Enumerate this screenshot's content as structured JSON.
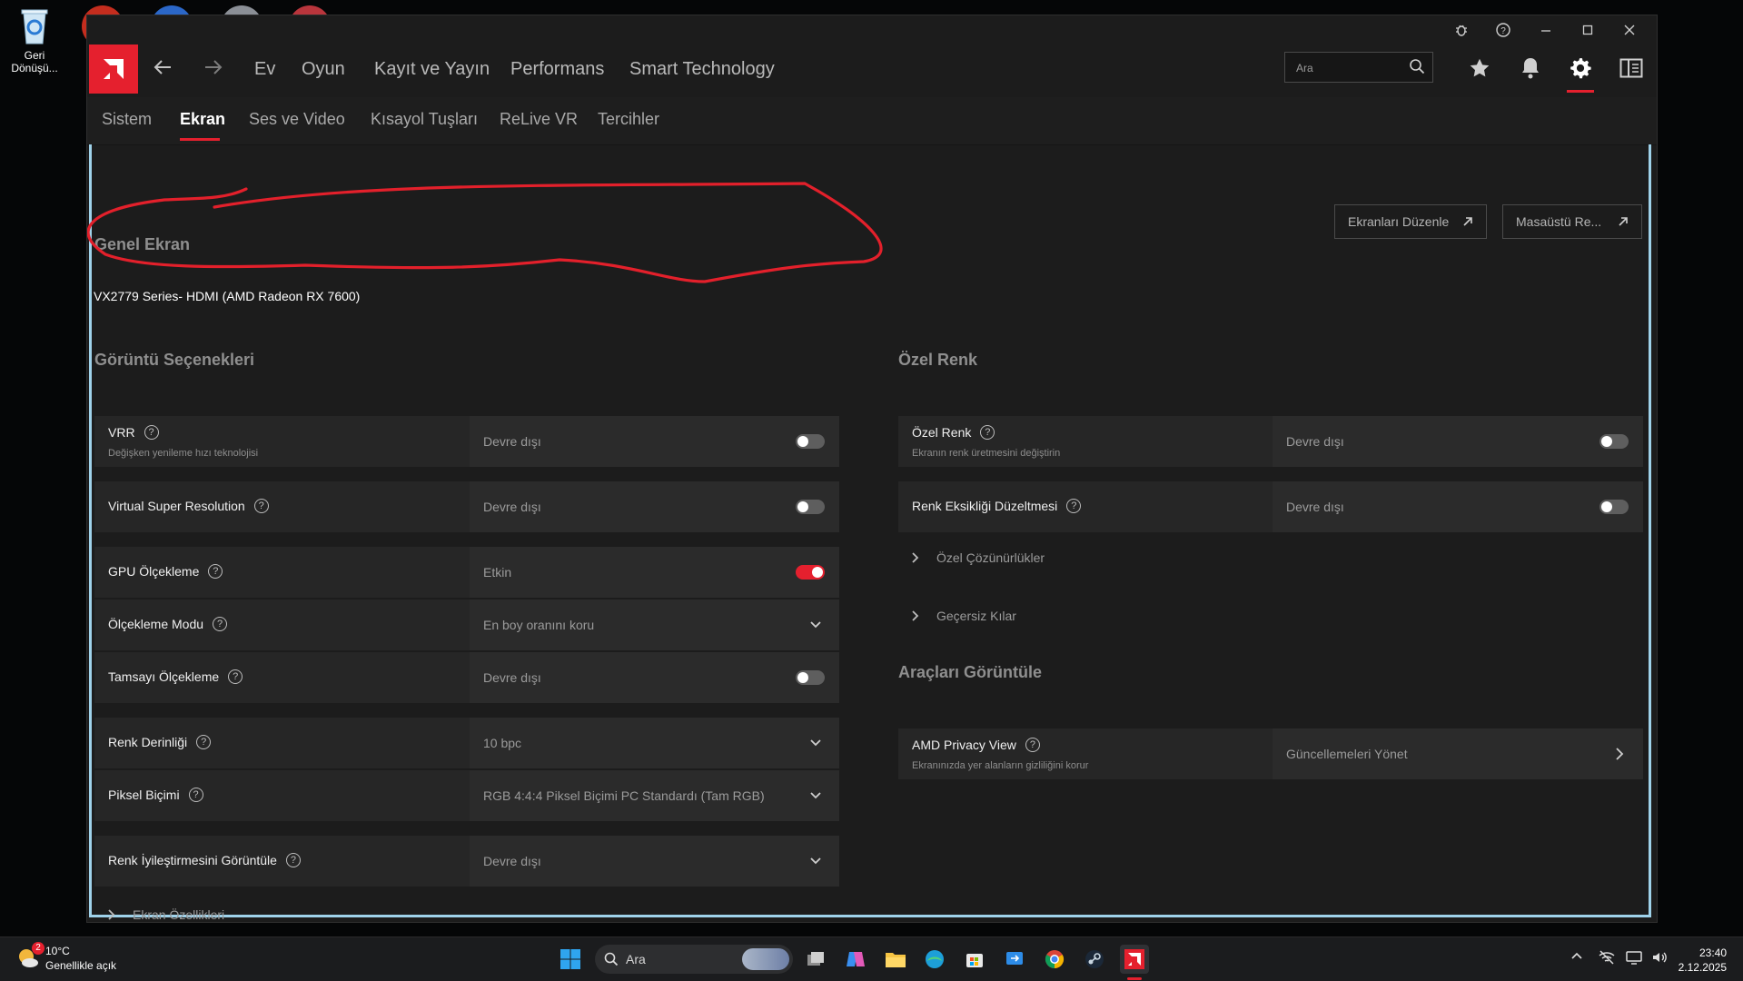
{
  "desktop": {
    "recycle_bin_label": "Geri Dönüşü..."
  },
  "nav": {
    "items": [
      "Ev",
      "Oyun",
      "Kayıt ve Yayın",
      "Performans",
      "Smart Technology"
    ],
    "search_placeholder": "Ara"
  },
  "tabs": [
    "Sistem",
    "Ekran",
    "Ses ve Video",
    "Kısayol Tuşları",
    "ReLive VR",
    "Tercihler"
  ],
  "active_tab": "Ekran",
  "general": {
    "title": "Genel Ekran",
    "monitor": "VX2779 Series- HDMI (AMD Radeon RX 7600)",
    "edit_displays_button": "Ekranları Düzenle",
    "desktop_button": "Masaüstü Re..."
  },
  "display_options": {
    "title": "Görüntü Seçenekleri",
    "rows": [
      {
        "label": "VRR",
        "sub": "Değişken yenileme hızı teknolojisi",
        "value": "Devre dışı",
        "control": "toggle",
        "on": false
      },
      {
        "label": "Virtual Super Resolution",
        "value": "Devre dışı",
        "control": "toggle",
        "on": false
      },
      {
        "label": "GPU Ölçekleme",
        "value": "Etkin",
        "control": "toggle",
        "on": true
      },
      {
        "label": "Ölçekleme Modu",
        "value": "En boy oranını koru",
        "control": "dropdown"
      },
      {
        "label": "Tamsayı Ölçekleme",
        "value": "Devre dışı",
        "control": "toggle",
        "on": false
      },
      {
        "label": "Renk Derinliği",
        "value": "10 bpc",
        "control": "dropdown"
      },
      {
        "label": "Piksel Biçimi",
        "value": "RGB 4:4:4 Piksel Biçimi PC Standardı (Tam RGB)",
        "control": "dropdown"
      },
      {
        "label": "Renk İyileştirmesini Görüntüle",
        "value": "Devre dışı",
        "control": "dropdown"
      }
    ],
    "expander_display_specs": "Ekran Özellikleri"
  },
  "custom_color": {
    "title": "Özel Renk",
    "rows": [
      {
        "label": "Özel Renk",
        "sub": "Ekranın renk üretmesini değiştirin",
        "value": "Devre dışı",
        "control": "toggle",
        "on": false
      },
      {
        "label": "Renk Eksikliği Düzeltmesi",
        "value": "Devre dışı",
        "control": "toggle",
        "on": false
      }
    ],
    "expanders": [
      "Özel Çözünürlükler",
      "Geçersiz Kılar"
    ]
  },
  "display_tools": {
    "title": "Araçları Görüntüle",
    "privacy_label": "AMD Privacy View",
    "privacy_sub": "Ekranınızda yer alanların gizliliğini korur",
    "privacy_value": "Güncellemeleri Yönet"
  },
  "taskbar": {
    "weather_temp": "10°C",
    "weather_desc": "Genellikle açık",
    "weather_badge": "2",
    "search_text": "Ara",
    "time": "23:40",
    "date": "2.12.2025"
  },
  "colors": {
    "accent": "#e5202e",
    "panel": "#262626",
    "frame": "#9fd2ea"
  }
}
